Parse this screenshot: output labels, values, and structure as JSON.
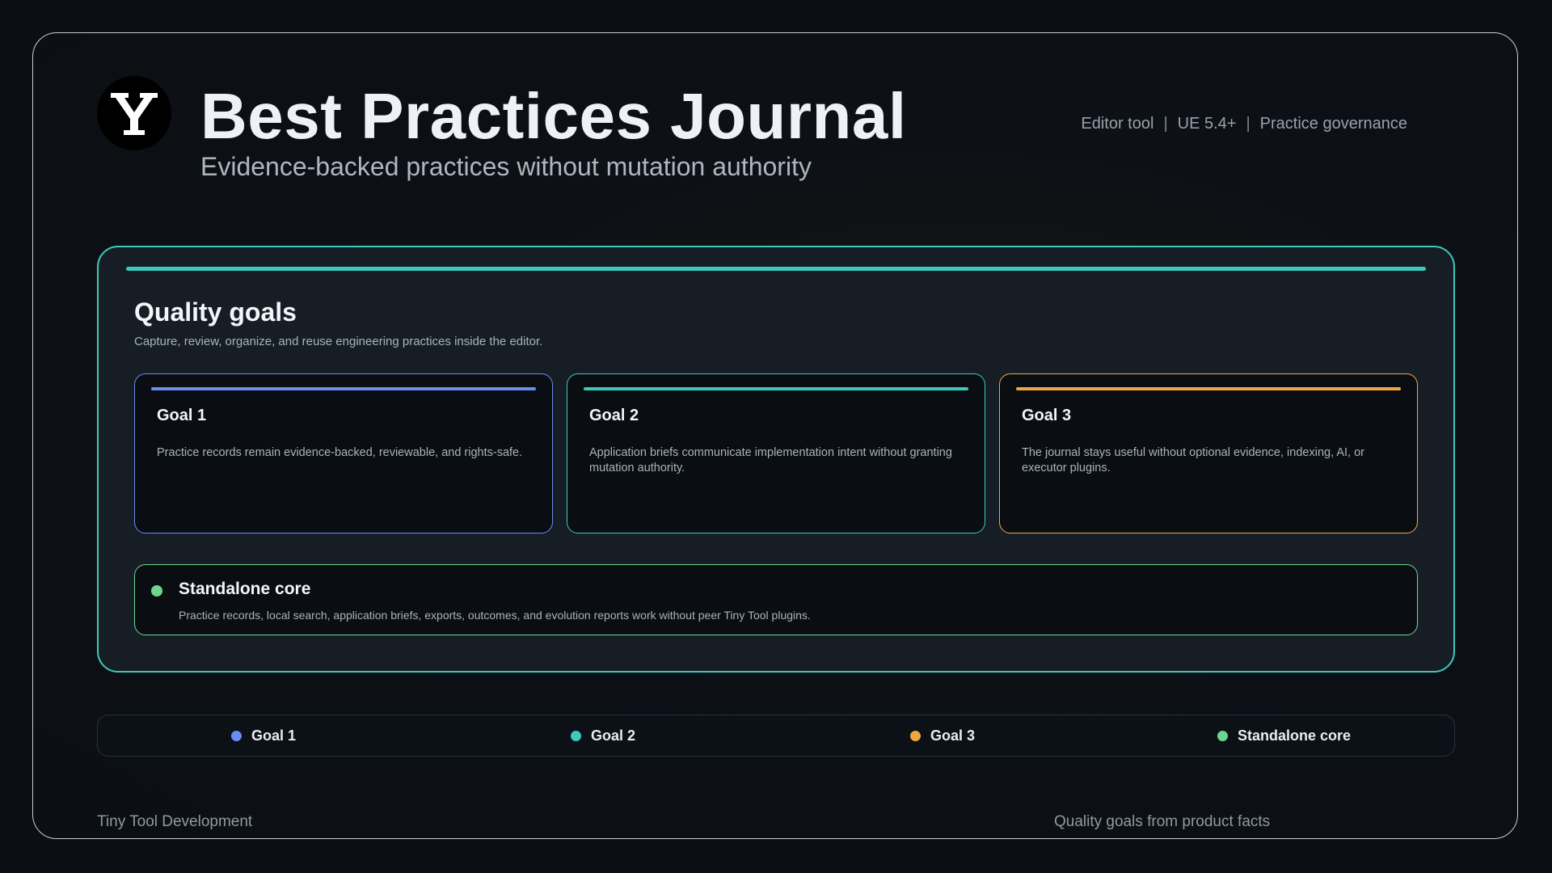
{
  "header": {
    "logo_icon": "y-logo-icon",
    "title": "Best Practices Journal",
    "subtitle": "Evidence-backed practices without mutation authority",
    "meta": [
      "Editor tool",
      "UE 5.4+",
      "Practice governance"
    ],
    "meta_separator": "|"
  },
  "panel": {
    "title": "Quality goals",
    "description": "Capture, review, organize, and reuse engineering practices inside the editor.",
    "accent_color": "#3ec9b8",
    "goals": [
      {
        "title": "Goal 1",
        "text": "Practice records remain evidence-backed, reviewable, and rights-safe.",
        "color": "#6b8cf0"
      },
      {
        "title": "Goal 2",
        "text": "Application briefs communicate implementation intent without granting mutation authority.",
        "color": "#3ec9b8"
      },
      {
        "title": "Goal 3",
        "text": "The journal stays useful without optional evidence, indexing, AI, or executor plugins.",
        "color": "#f0a742"
      }
    ],
    "core": {
      "title": "Standalone core",
      "text": "Practice records, local search, application briefs, exports, outcomes, and evolution reports work without peer Tiny Tool plugins.",
      "color": "#6dd68f"
    }
  },
  "legend": {
    "items": [
      {
        "label": "Goal 1",
        "color": "#6b8cf0"
      },
      {
        "label": "Goal 2",
        "color": "#3ec9b8"
      },
      {
        "label": "Goal 3",
        "color": "#f0a742"
      },
      {
        "label": "Standalone core",
        "color": "#6dd68f"
      }
    ]
  },
  "footer": {
    "left": "Tiny Tool Development",
    "right": "Quality goals from product facts"
  }
}
